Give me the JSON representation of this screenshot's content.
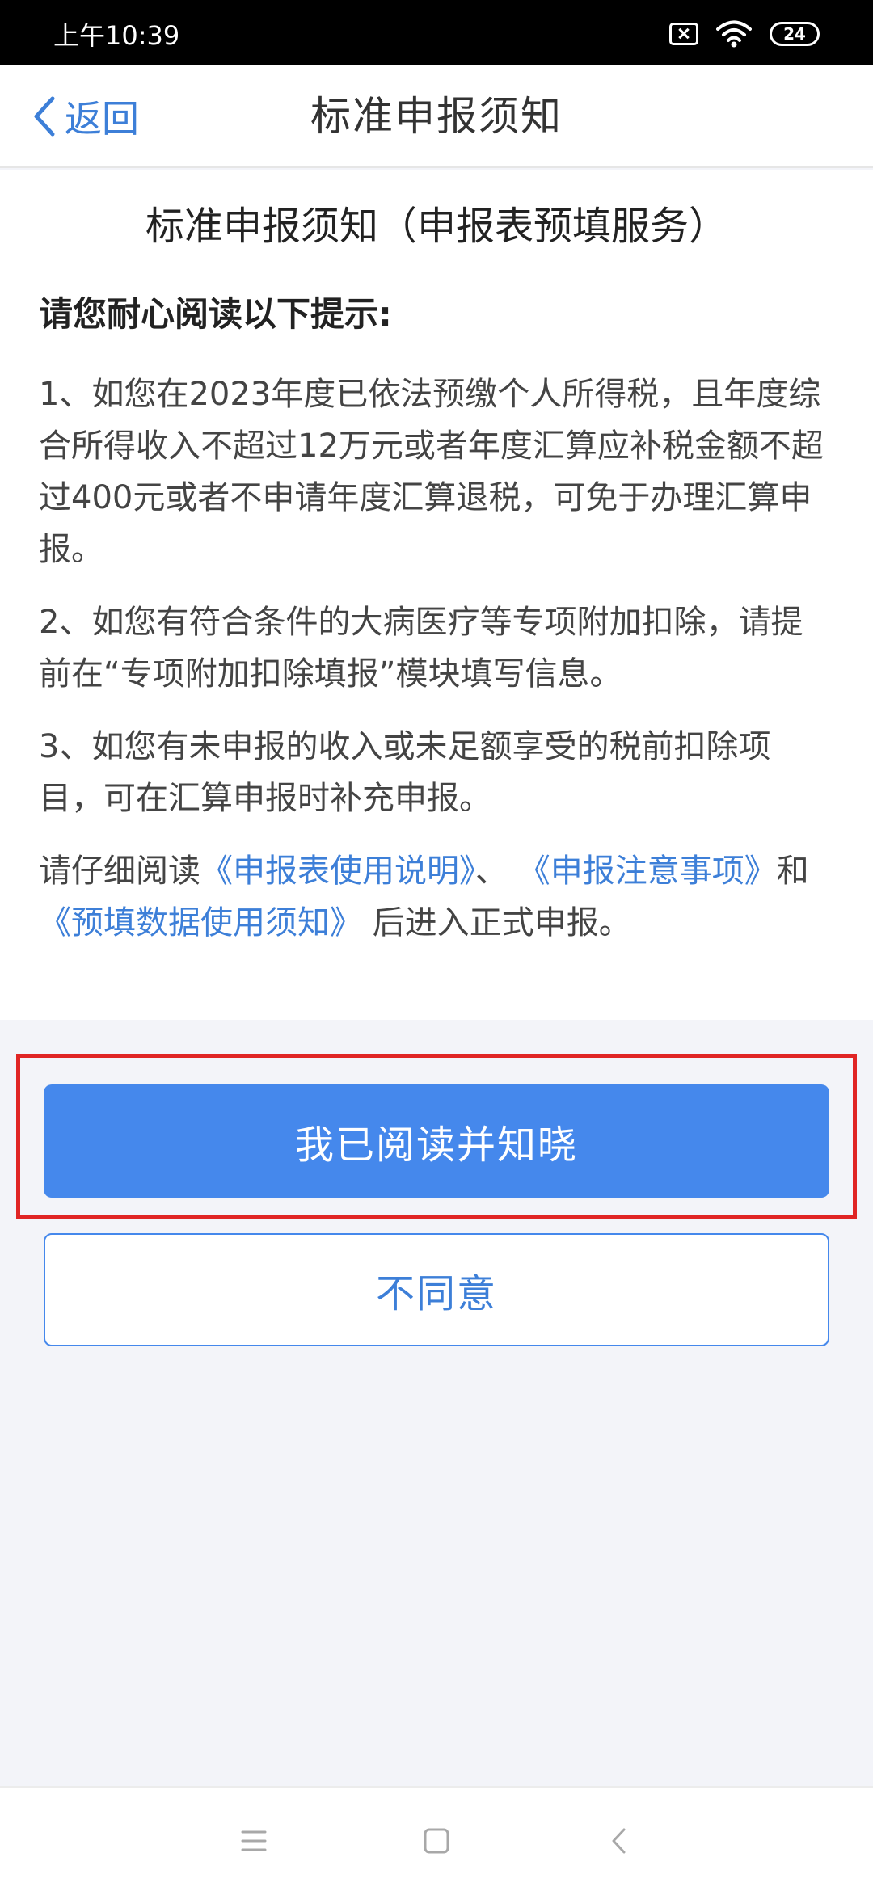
{
  "status_bar": {
    "time": "上午10:39",
    "battery": "24"
  },
  "nav": {
    "back_label": "返回",
    "title": "标准申报须知"
  },
  "content": {
    "title": "标准申报须知（申报表预填服务）",
    "intro": "请您耐心阅读以下提示:",
    "items": [
      "1、如您在2023年度已依法预缴个人所得税，且年度综合所得收入不超过12万元或者年度汇算应补税金额不超过400元或者不申请年度汇算退税，可免于办理汇算申报。",
      "2、如您有符合条件的大病医疗等专项附加扣除，请提前在“专项附加扣除填报”模块填写信息。",
      "3、如您有未申报的收入或未足额享受的税前扣除项目，可在汇算申报时补充申报。"
    ],
    "reading": {
      "prefix": "请仔细阅读",
      "link1": "《申报表使用说明》",
      "sep1": "、",
      "link2": "《申报注意事项》",
      "sep2": "和",
      "link3": "《预填数据使用须知》",
      "suffix": "后进入正式申报。"
    }
  },
  "actions": {
    "agree_label": "我已阅读并知晓",
    "decline_label": "不同意"
  },
  "colors": {
    "accent": "#4588ec",
    "link": "#3d7fd8",
    "highlight_frame": "#e02525"
  },
  "icons": {
    "back": "chevron-left-icon",
    "sim": "no-sim-icon",
    "wifi": "wifi-icon",
    "battery": "battery-icon",
    "menu": "menu-icon",
    "home": "home-icon",
    "system_back": "system-back-icon"
  }
}
